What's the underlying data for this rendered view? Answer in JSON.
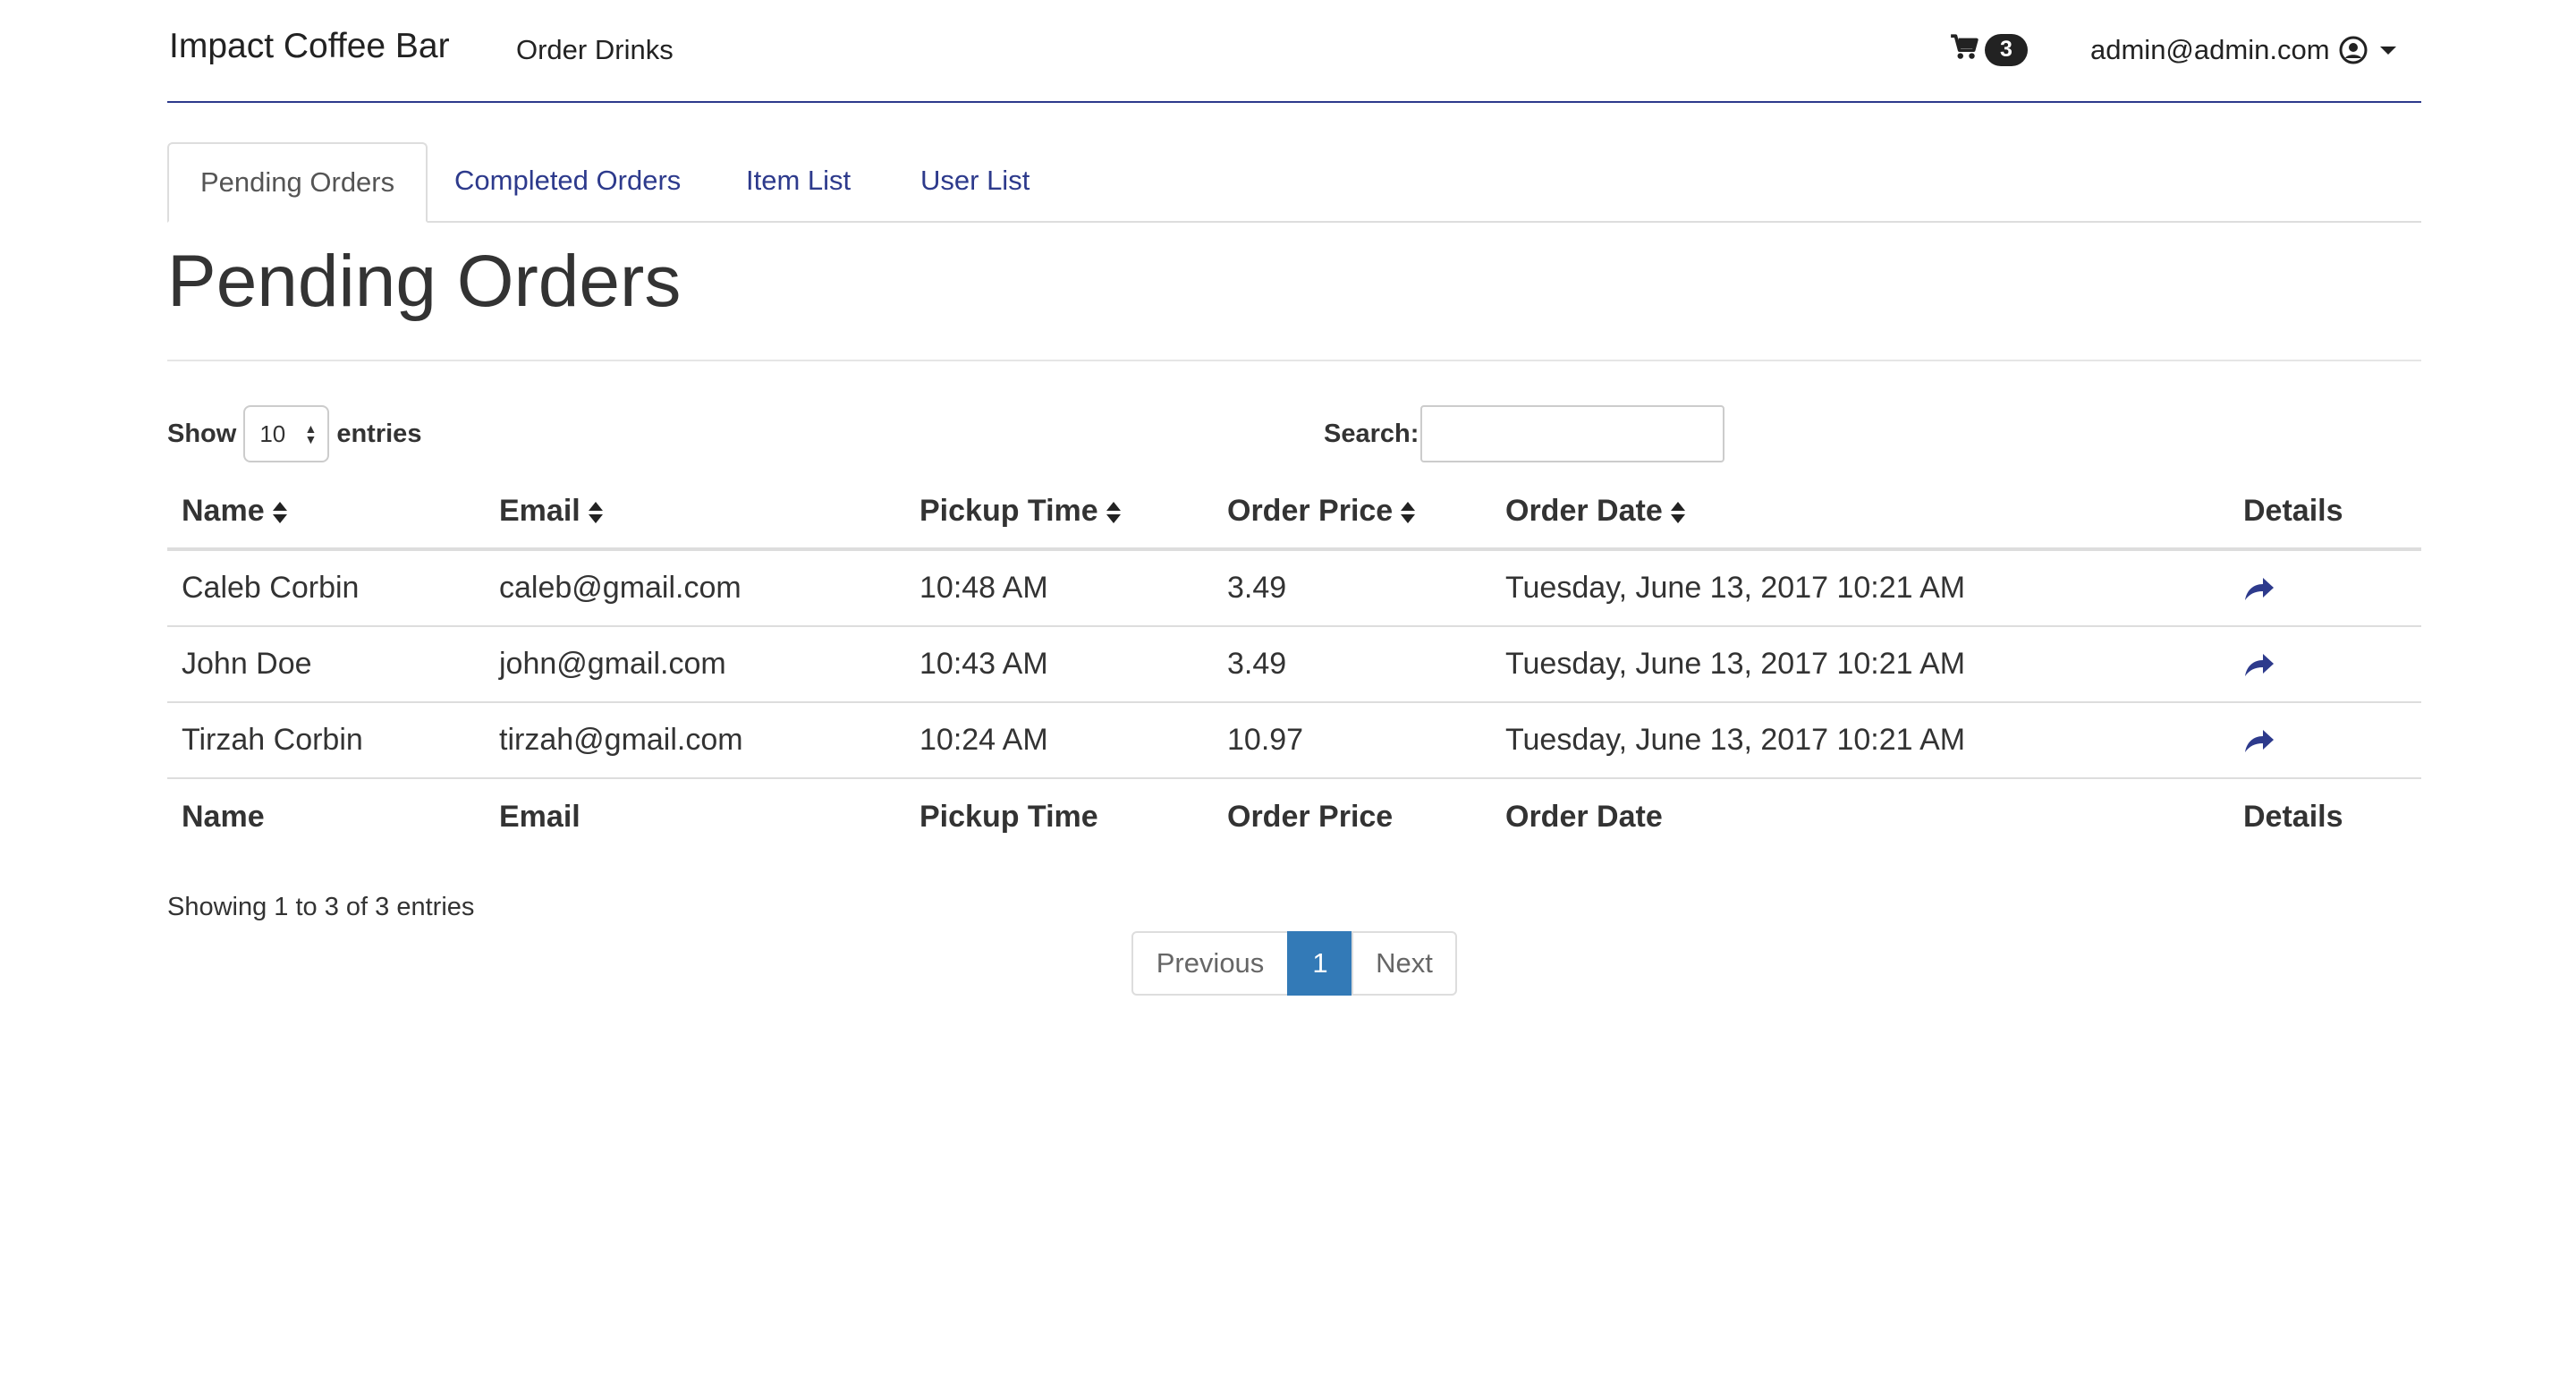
{
  "navbar": {
    "brand": "Impact Coffee Bar",
    "order_drinks": "Order Drinks",
    "cart_count": "3",
    "user_email": "admin@admin.com"
  },
  "tabs": [
    {
      "label": "Pending Orders",
      "active": true
    },
    {
      "label": "Completed Orders",
      "active": false
    },
    {
      "label": "Item List",
      "active": false
    },
    {
      "label": "User List",
      "active": false
    }
  ],
  "page_title": "Pending Orders",
  "controls": {
    "show_label": "Show",
    "entries_value": "10",
    "entries_label": "entries",
    "search_label": "Search:",
    "search_value": ""
  },
  "table": {
    "headers": [
      "Name",
      "Email",
      "Pickup Time",
      "Order Price",
      "Order Date",
      "Details"
    ],
    "rows": [
      {
        "name": "Caleb Corbin",
        "email": "caleb@gmail.com",
        "pickup": "10:48 AM",
        "price": "3.49",
        "date": "Tuesday, June 13, 2017 10:21 AM"
      },
      {
        "name": "John Doe",
        "email": "john@gmail.com",
        "pickup": "10:43 AM",
        "price": "3.49",
        "date": "Tuesday, June 13, 2017 10:21 AM"
      },
      {
        "name": "Tirzah Corbin",
        "email": "tirzah@gmail.com",
        "pickup": "10:24 AM",
        "price": "10.97",
        "date": "Tuesday, June 13, 2017 10:21 AM"
      }
    ]
  },
  "info": "Showing 1 to 3 of 3 entries",
  "pagination": {
    "previous": "Previous",
    "current": "1",
    "next": "Next"
  },
  "colors": {
    "accent": "#2d3a8c",
    "active_page": "#337ab7"
  }
}
